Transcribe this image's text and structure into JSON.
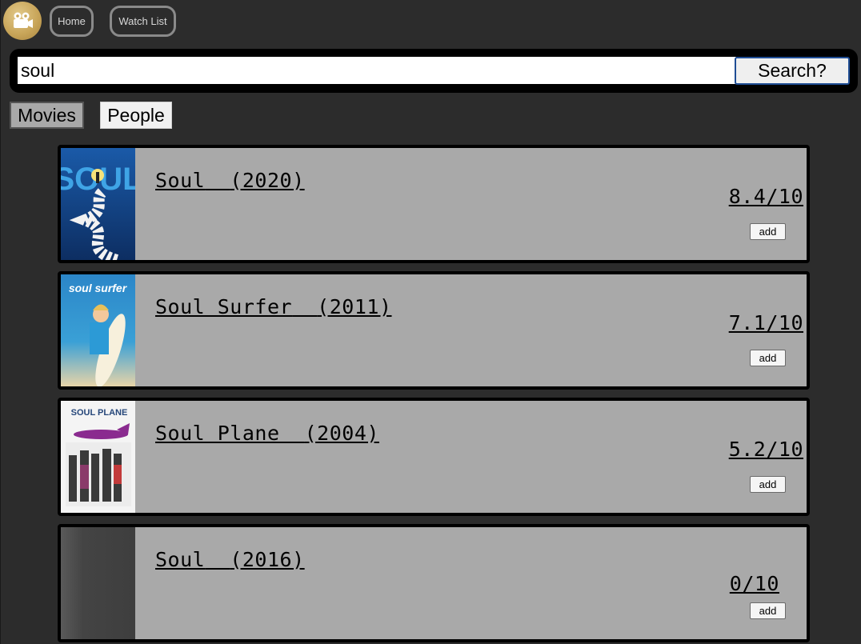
{
  "nav": {
    "logo_icon": "film-camera-icon",
    "home_label": "Home",
    "watchlist_label": "Watch List"
  },
  "search": {
    "query": "soul",
    "button_label": "Search?"
  },
  "tabs": {
    "movies_label": "Movies",
    "people_label": "People",
    "active": "Movies"
  },
  "results": [
    {
      "title": "Soul",
      "year": "(2020)",
      "rating": "8.4/10",
      "add_label": "add",
      "poster_text": "SOUL"
    },
    {
      "title": "Soul Surfer",
      "year": "(2011)",
      "rating": "7.1/10",
      "add_label": "add",
      "poster_text": "soul surfer"
    },
    {
      "title": "Soul Plane",
      "year": "(2004)",
      "rating": "5.2/10",
      "add_label": "add",
      "poster_text": "SOUL PLANE"
    },
    {
      "title": "Soul",
      "year": "(2016)",
      "rating": "0/10",
      "add_label": "add",
      "poster_text": ""
    }
  ],
  "colors": {
    "background": "#2c2c2c",
    "card": "#a9a9a9",
    "border": "#000000",
    "logo": "#c9a65a",
    "search_border": "#1f4d94"
  }
}
